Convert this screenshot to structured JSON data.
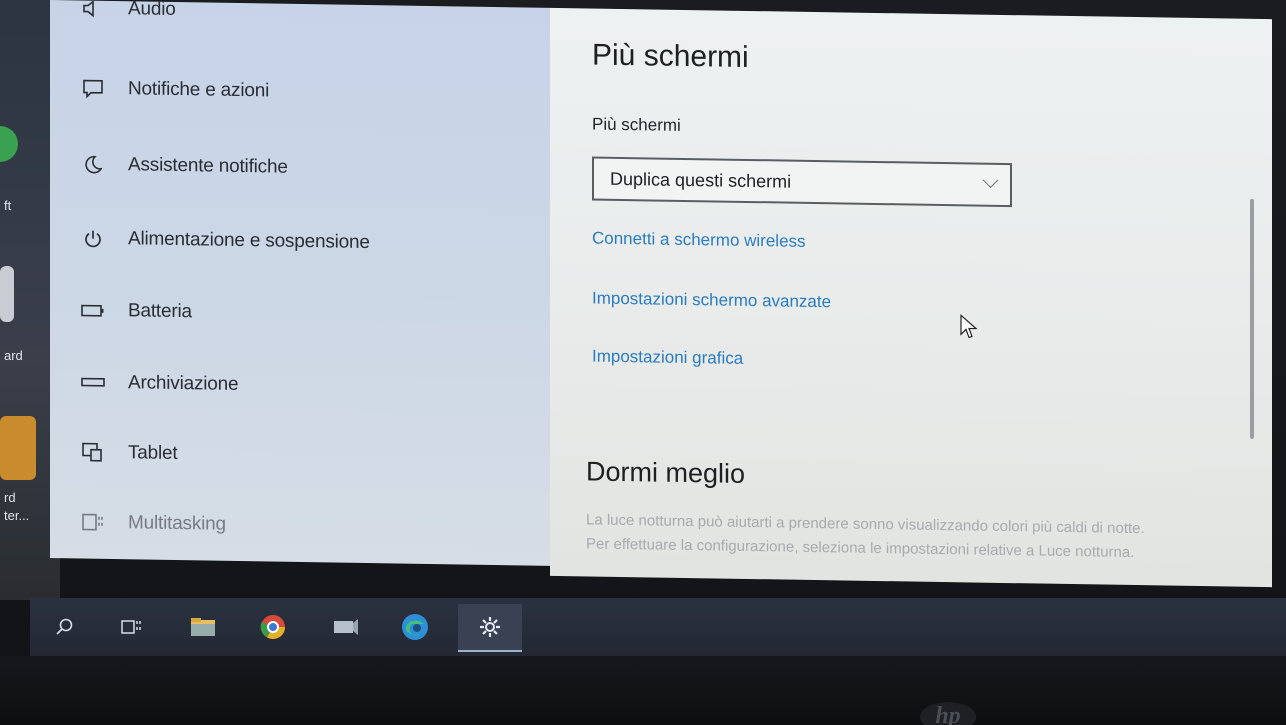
{
  "desktop": {
    "fragments": [
      "ft",
      "ard",
      "rd",
      "ter..."
    ]
  },
  "sidebar": {
    "items": [
      {
        "label": "Audio",
        "icon": "speaker-icon"
      },
      {
        "label": "Notifiche e azioni",
        "icon": "notification-icon"
      },
      {
        "label": "Assistente notifiche",
        "icon": "moon-icon"
      },
      {
        "label": "Alimentazione e sospensione",
        "icon": "power-icon"
      },
      {
        "label": "Batteria",
        "icon": "battery-icon"
      },
      {
        "label": "Archiviazione",
        "icon": "storage-icon"
      },
      {
        "label": "Tablet",
        "icon": "tablet-icon"
      },
      {
        "label": "Multitasking",
        "icon": "multitasking-icon"
      }
    ]
  },
  "content": {
    "title": "Più schermi",
    "select_label": "Più schermi",
    "select_value": "Duplica questi schermi",
    "links": [
      "Connetti a schermo wireless",
      "Impostazioni schermo avanzate",
      "Impostazioni grafica"
    ],
    "section2_title": "Dormi meglio",
    "section2_body": "La luce notturna può aiutarti a prendere sonno visualizzando colori più caldi di notte. Per effettuare la configurazione, seleziona le impostazioni relative a Luce notturna."
  },
  "taskbar": {
    "items": [
      "search-icon",
      "task-view-icon",
      "file-explorer-icon",
      "chrome-icon",
      "app-icon",
      "edge-icon",
      "settings-icon"
    ],
    "active": "settings-icon"
  },
  "colors": {
    "link": "#2a7cc0",
    "sidebar_bg": "#c7d4e8",
    "content_bg": "#eef1f2",
    "taskbar_bg": "#2a3140"
  },
  "brand": "hp"
}
